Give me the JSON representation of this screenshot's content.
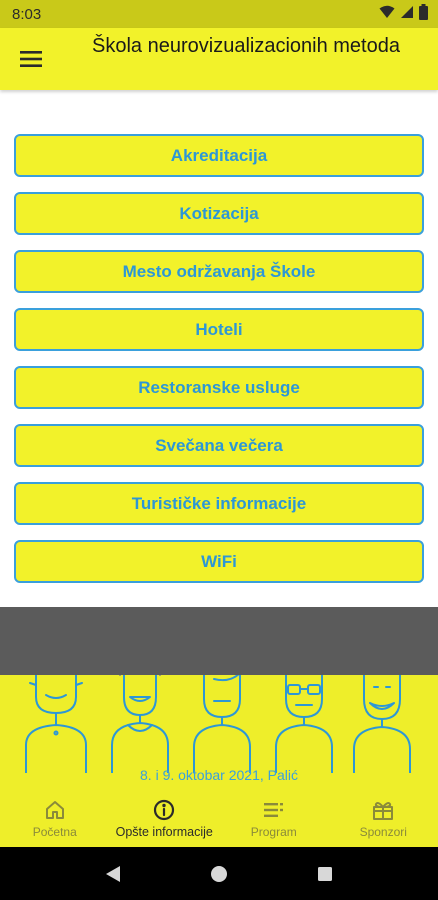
{
  "status_bar": {
    "time": "8:03"
  },
  "app_bar": {
    "title": "Škola neurovizualizacionih metoda"
  },
  "menu": {
    "items": [
      {
        "label": "Akreditacija"
      },
      {
        "label": "Kotizacija"
      },
      {
        "label": "Mesto održavanja Škole"
      },
      {
        "label": "Hoteli"
      },
      {
        "label": "Restoranske usluge"
      },
      {
        "label": "Svečana večera"
      },
      {
        "label": "Turističke informacije"
      },
      {
        "label": "WiFi"
      }
    ]
  },
  "banner": {
    "date_text": "8. i 9. oktobar 2021, Palić"
  },
  "bottom_nav": {
    "items": [
      {
        "label": "Početna",
        "icon": "home-icon"
      },
      {
        "label": "Opšte informacije",
        "icon": "info-icon",
        "active": true
      },
      {
        "label": "Program",
        "icon": "list-icon"
      },
      {
        "label": "Sponzori",
        "icon": "gift-icon"
      }
    ]
  },
  "colors": {
    "primary_yellow": "#f2f22a",
    "status_yellow": "#c9c919",
    "accent_blue": "#2d97d6",
    "gray_band": "#5b5b5b"
  }
}
